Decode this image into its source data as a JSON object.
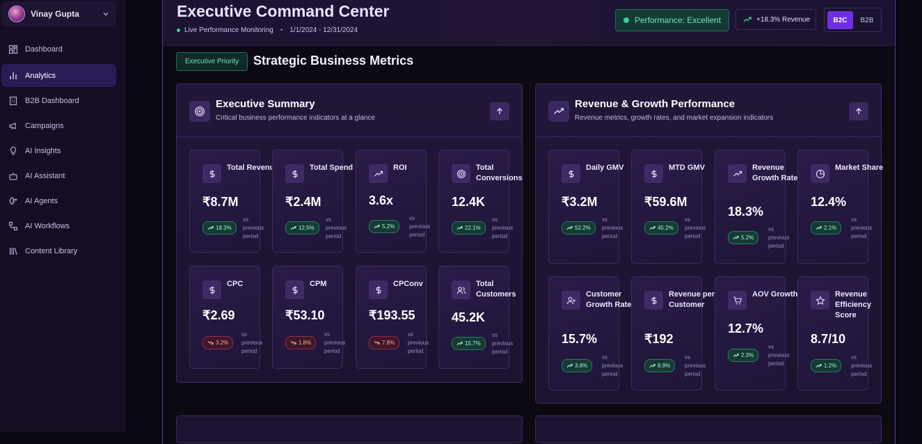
{
  "user": {
    "name": "Vinay Gupta"
  },
  "sidebar": {
    "items": [
      {
        "label": "Dashboard",
        "icon": "grid-icon"
      },
      {
        "label": "Analytics",
        "icon": "bar-chart-icon",
        "active": true
      },
      {
        "label": "B2B Dashboard",
        "icon": "building-icon"
      },
      {
        "label": "Campaigns",
        "icon": "megaphone-icon"
      },
      {
        "label": "AI Insights",
        "icon": "lightbulb-icon"
      },
      {
        "label": "AI Assistant",
        "icon": "bot-icon"
      },
      {
        "label": "AI Agents",
        "icon": "brain-icon"
      },
      {
        "label": "AI Workflows",
        "icon": "workflow-icon"
      },
      {
        "label": "Content Library",
        "icon": "library-icon"
      }
    ]
  },
  "header": {
    "title": "Executive Command Center",
    "live": "Live Performance Monitoring",
    "date_range": "1/1/2024 - 12/31/2024",
    "performance": "Performance: Excellent",
    "revenue_badge": "+18.3% Revenue",
    "segment": {
      "options": [
        "B2C",
        "B2B"
      ],
      "selected": "B2C"
    }
  },
  "section": {
    "priority": "Executive Priority",
    "title": "Strategic Business Metrics"
  },
  "vs_text": "vs previous period",
  "panels": [
    {
      "title": "Executive Summary",
      "subtitle": "Critical business performance indicators at a glance",
      "icon": "target-icon",
      "cards": [
        {
          "label": "Total Revenue",
          "value": "₹8.7M",
          "change": "18.3%",
          "direction": "up",
          "icon": "dollar-icon"
        },
        {
          "label": "Total Spend",
          "value": "₹2.4M",
          "change": "12.5%",
          "direction": "up",
          "icon": "dollar-icon"
        },
        {
          "label": "ROI",
          "value": "3.6x",
          "change": "5.2%",
          "direction": "up",
          "icon": "trending-up-icon"
        },
        {
          "label": "Total Conversions",
          "value": "12.4K",
          "change": "22.1%",
          "direction": "up",
          "icon": "target-icon"
        },
        {
          "label": "CPC",
          "value": "₹2.69",
          "change": "3.2%",
          "direction": "down",
          "icon": "dollar-icon"
        },
        {
          "label": "CPM",
          "value": "₹53.10",
          "change": "1.8%",
          "direction": "down",
          "icon": "dollar-icon"
        },
        {
          "label": "CPConv",
          "value": "₹193.55",
          "change": "7.8%",
          "direction": "down",
          "icon": "dollar-icon"
        },
        {
          "label": "Total Customers",
          "value": "45.2K",
          "change": "15.7%",
          "direction": "up",
          "icon": "users-icon"
        }
      ]
    },
    {
      "title": "Revenue & Growth Performance",
      "subtitle": "Revenue metrics, growth rates, and market expansion indicators",
      "icon": "trending-up-icon",
      "cards": [
        {
          "label": "Daily GMV",
          "value": "₹3.2M",
          "change": "52.2%",
          "direction": "up",
          "icon": "dollar-icon"
        },
        {
          "label": "MTD GMV",
          "value": "₹59.6M",
          "change": "45.2%",
          "direction": "up",
          "icon": "dollar-icon"
        },
        {
          "label": "Revenue Growth Rate",
          "value": "18.3%",
          "change": "5.2%",
          "direction": "up",
          "icon": "trending-up-icon"
        },
        {
          "label": "Market Share",
          "value": "12.4%",
          "change": "2.1%",
          "direction": "up",
          "icon": "pie-chart-icon"
        },
        {
          "label": "Customer Growth Rate",
          "value": "15.7%",
          "change": "3.8%",
          "direction": "up",
          "icon": "user-plus-icon"
        },
        {
          "label": "Revenue per Customer",
          "value": "₹192",
          "change": "8.9%",
          "direction": "up",
          "icon": "dollar-icon"
        },
        {
          "label": "AOV Growth",
          "value": "12.7%",
          "change": "2.3%",
          "direction": "up",
          "icon": "cart-icon"
        },
        {
          "label": "Revenue Efficiency Score",
          "value": "8.7/10",
          "change": "1.2%",
          "direction": "up",
          "icon": "star-icon"
        }
      ]
    }
  ],
  "colors": {
    "accent": "#6d2ee6",
    "positive": "#34d399",
    "negative": "#f87171",
    "background": "#0c0913"
  }
}
